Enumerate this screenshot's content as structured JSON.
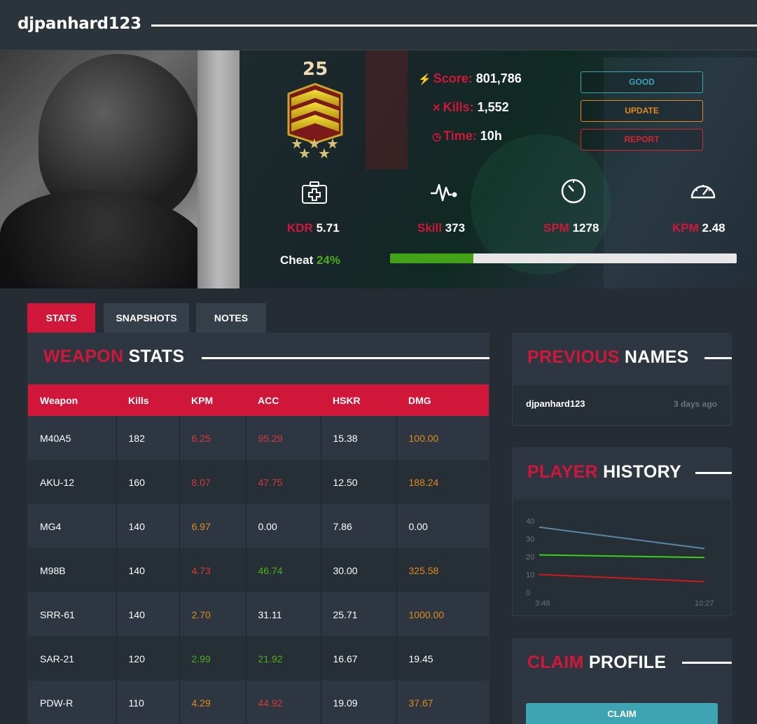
{
  "header": {
    "username": "djpanhard123"
  },
  "rank": {
    "level": "25"
  },
  "summary": {
    "score_label": "Score:",
    "score": "801,786",
    "kills_label": "Kills:",
    "kills": "1,552",
    "time_label": "Time:",
    "time": "10h"
  },
  "actions": {
    "good": "GOOD",
    "update": "UPDATE",
    "report": "REPORT"
  },
  "metrics": {
    "kdr_label": "KDR",
    "kdr": "5.71",
    "skill_label": "Skill",
    "skill": "373",
    "spm_label": "SPM",
    "spm": "1278",
    "kpm_label": "KPM",
    "kpm": "2.48"
  },
  "cheat": {
    "label": "Cheat",
    "value": "24%",
    "fraction": 0.24
  },
  "tabs": [
    {
      "label": "STATS",
      "active": true
    },
    {
      "label": "SNAPSHOTS",
      "active": false
    },
    {
      "label": "NOTES",
      "active": false
    }
  ],
  "weapon_stats": {
    "title_red": "WEAPON",
    "title_white": "STATS",
    "columns": [
      "Weapon",
      "Kills",
      "KPM",
      "ACC",
      "HSKR",
      "DMG"
    ],
    "rows": [
      [
        "M40A5",
        "182",
        "6.25",
        "95.29",
        "15.38",
        "100.00"
      ],
      [
        "AKU-12",
        "160",
        "8.07",
        "47.75",
        "12.50",
        "188.24"
      ],
      [
        "MG4",
        "140",
        "6.97",
        "0.00",
        "7.86",
        "0.00"
      ],
      [
        "M98B",
        "140",
        "4.73",
        "46.74",
        "30.00",
        "325.58"
      ],
      [
        "SRR-61",
        "140",
        "2.70",
        "31.11",
        "25.71",
        "1000.00"
      ],
      [
        "SAR-21",
        "120",
        "2.99",
        "21.92",
        "16.67",
        "19.45"
      ],
      [
        "PDW-R",
        "110",
        "4.29",
        "44.92",
        "19.09",
        "37.67"
      ]
    ],
    "cell_colors": [
      [
        "",
        "",
        "red",
        "red",
        "",
        "orange"
      ],
      [
        "",
        "",
        "red",
        "red",
        "",
        "orange"
      ],
      [
        "",
        "",
        "orange",
        "",
        "",
        ""
      ],
      [
        "",
        "",
        "red",
        "green",
        "",
        "orange"
      ],
      [
        "",
        "",
        "orange",
        "",
        "",
        "orange"
      ],
      [
        "",
        "",
        "green",
        "green",
        "",
        ""
      ],
      [
        "",
        "",
        "orange",
        "red",
        "",
        "orange"
      ]
    ]
  },
  "previous_names": {
    "title_red": "PREVIOUS",
    "title_white": "NAMES",
    "entries": [
      {
        "name": "djpanhard123",
        "when": "3 days ago"
      }
    ]
  },
  "player_history": {
    "title_red": "PLAYER",
    "title_white": "HISTORY",
    "chart_data": {
      "type": "line",
      "x": [
        "3:48",
        "10:27"
      ],
      "ylim": [
        0,
        40
      ],
      "yticks": [
        0,
        10,
        20,
        30,
        40
      ],
      "series": [
        {
          "values": [
            36.5,
            24.5
          ],
          "color": "#5b87a8"
        },
        {
          "values": [
            21,
            19.5
          ],
          "color": "#3bd11a"
        },
        {
          "values": [
            10,
            6
          ],
          "color": "#d0171a"
        }
      ]
    }
  },
  "claim": {
    "title_red": "CLAIM",
    "title_white": "PROFILE",
    "button": "CLAIM"
  },
  "colors": {
    "accent": "#d0173a",
    "good": "#3ea3b3",
    "update": "#e08a1e",
    "report": "#d3262e",
    "cheat_fill": "#43a117"
  }
}
